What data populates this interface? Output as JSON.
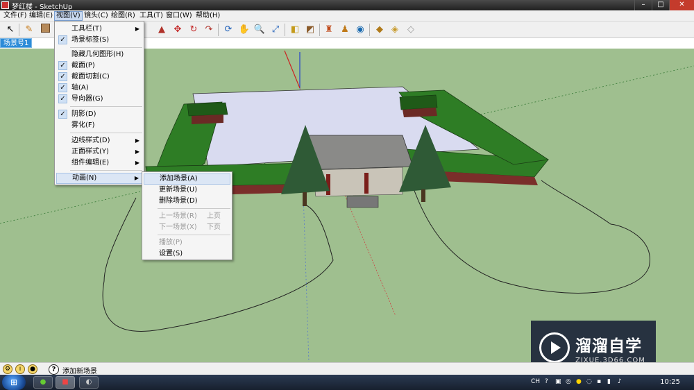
{
  "window": {
    "title": "梦红楼 - SketchUp",
    "minimize": "–",
    "maximize": "□",
    "close": "✕"
  },
  "menubar": {
    "items": [
      "文件(F)",
      "编辑(E)",
      "视图(V)",
      "镜头(C)",
      "绘图(R)",
      "工具(T)",
      "窗口(W)",
      "帮助(H)"
    ],
    "active_index": 2
  },
  "toolbar": {
    "icons": [
      "select-arrow-icon",
      "pencil-icon",
      "eraser-icon",
      "orbit-icon",
      "pan-hand-icon",
      "zoom-icon",
      "zoom-extents-icon",
      "section-plane-icon",
      "walk-icon",
      "look-around-icon",
      "position-camera-icon",
      "get-models-icon",
      "share-model-icon",
      "components-icon"
    ]
  },
  "viewport": {
    "scene_tab": "场景号1"
  },
  "view_menu": {
    "items": [
      {
        "label": "工具栏(T)",
        "checked": false,
        "submenu": true
      },
      {
        "label": "场景标签(S)",
        "checked": true,
        "submenu": false
      },
      {
        "label": "隐藏几何图形(H)",
        "checked": false,
        "submenu": false
      },
      {
        "label": "截面(P)",
        "checked": true,
        "submenu": false
      },
      {
        "label": "截面切割(C)",
        "checked": true,
        "submenu": false
      },
      {
        "label": "轴(A)",
        "checked": true,
        "submenu": false
      },
      {
        "label": "导向器(G)",
        "checked": true,
        "submenu": false
      },
      {
        "label": "阴影(D)",
        "checked": true,
        "submenu": false
      },
      {
        "label": "雾化(F)",
        "checked": false,
        "submenu": false
      },
      {
        "label": "边线样式(D)",
        "checked": false,
        "submenu": true
      },
      {
        "label": "正面样式(Y)",
        "checked": false,
        "submenu": true
      },
      {
        "label": "组件编辑(E)",
        "checked": false,
        "submenu": true
      },
      {
        "label": "动画(N)",
        "checked": false,
        "submenu": true
      }
    ]
  },
  "animation_menu": {
    "items": [
      {
        "label": "添加场景(A)",
        "shortcut": "",
        "disabled": false
      },
      {
        "label": "更新场景(U)",
        "shortcut": "",
        "disabled": false
      },
      {
        "label": "删除场景(D)",
        "shortcut": "",
        "disabled": false
      },
      {
        "label": "上一场景(R)",
        "shortcut": "上页",
        "disabled": true
      },
      {
        "label": "下一场景(X)",
        "shortcut": "下页",
        "disabled": true
      },
      {
        "label": "播放(P)",
        "shortcut": "",
        "disabled": true
      },
      {
        "label": "设置(S)",
        "shortcut": "",
        "disabled": false
      }
    ]
  },
  "statusbar": {
    "help_icon": "?",
    "text": "添加新场景"
  },
  "watermark": {
    "main": "溜溜自学",
    "sub": "ZIXUE.3D66.COM"
  },
  "taskbar": {
    "tray_lang": "CH",
    "clock": "10:25"
  },
  "colors": {
    "ground": "#9fbf8f",
    "roof_green": "#2e7d25",
    "courtyard": "#d9dbf0",
    "menu_highlight": "#dbe6f5"
  }
}
